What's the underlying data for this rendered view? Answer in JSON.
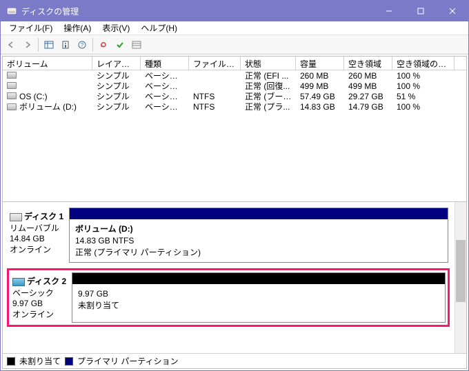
{
  "titlebar": {
    "icon": "disk-management-icon",
    "title": "ディスクの管理"
  },
  "menubar": {
    "file": "ファイル(F)",
    "action": "操作(A)",
    "view": "表示(V)",
    "help": "ヘルプ(H)"
  },
  "volume_list": {
    "headers": {
      "volume": "ボリューム",
      "layout": "レイアウト",
      "type": "種類",
      "filesystem": "ファイル システム",
      "status": "状態",
      "capacity": "容量",
      "free": "空き領域",
      "free_pct": "空き領域の割..."
    },
    "rows": [
      {
        "volume": "",
        "layout": "シンプル",
        "type": "ベーシック",
        "fs": "",
        "status": "正常 (EFI ...",
        "cap": "260 MB",
        "free": "260 MB",
        "pct": "100 %"
      },
      {
        "volume": "",
        "layout": "シンプル",
        "type": "ベーシック",
        "fs": "",
        "status": "正常 (回復...",
        "cap": "499 MB",
        "free": "499 MB",
        "pct": "100 %"
      },
      {
        "volume": "OS (C:)",
        "layout": "シンプル",
        "type": "ベーシック",
        "fs": "NTFS",
        "status": "正常 (ブート...",
        "cap": "57.49 GB",
        "free": "29.27 GB",
        "pct": "51 %"
      },
      {
        "volume": "ボリューム (D:)",
        "layout": "シンプル",
        "type": "ベーシック",
        "fs": "NTFS",
        "status": "正常 (プラ...",
        "cap": "14.83 GB",
        "free": "14.79 GB",
        "pct": "100 %"
      }
    ]
  },
  "disks": [
    {
      "name": "ディスク 1",
      "kind": "リムーバブル",
      "size": "14.84 GB",
      "state": "オンライン",
      "bar_style": "navy",
      "part_title": "ボリューム  (D:)",
      "part_line1": "14.83 GB NTFS",
      "part_line2": "正常 (プライマリ パーティション)",
      "highlight": false,
      "icon_blue": false
    },
    {
      "name": "ディスク 2",
      "kind": "ベーシック",
      "size": "9.97 GB",
      "state": "オンライン",
      "bar_style": "black",
      "part_title": "",
      "part_line1": "9.97 GB",
      "part_line2": "未割り当て",
      "highlight": true,
      "icon_blue": true
    }
  ],
  "legend": {
    "unallocated": "未割り当て",
    "primary": "プライマリ パーティション"
  }
}
